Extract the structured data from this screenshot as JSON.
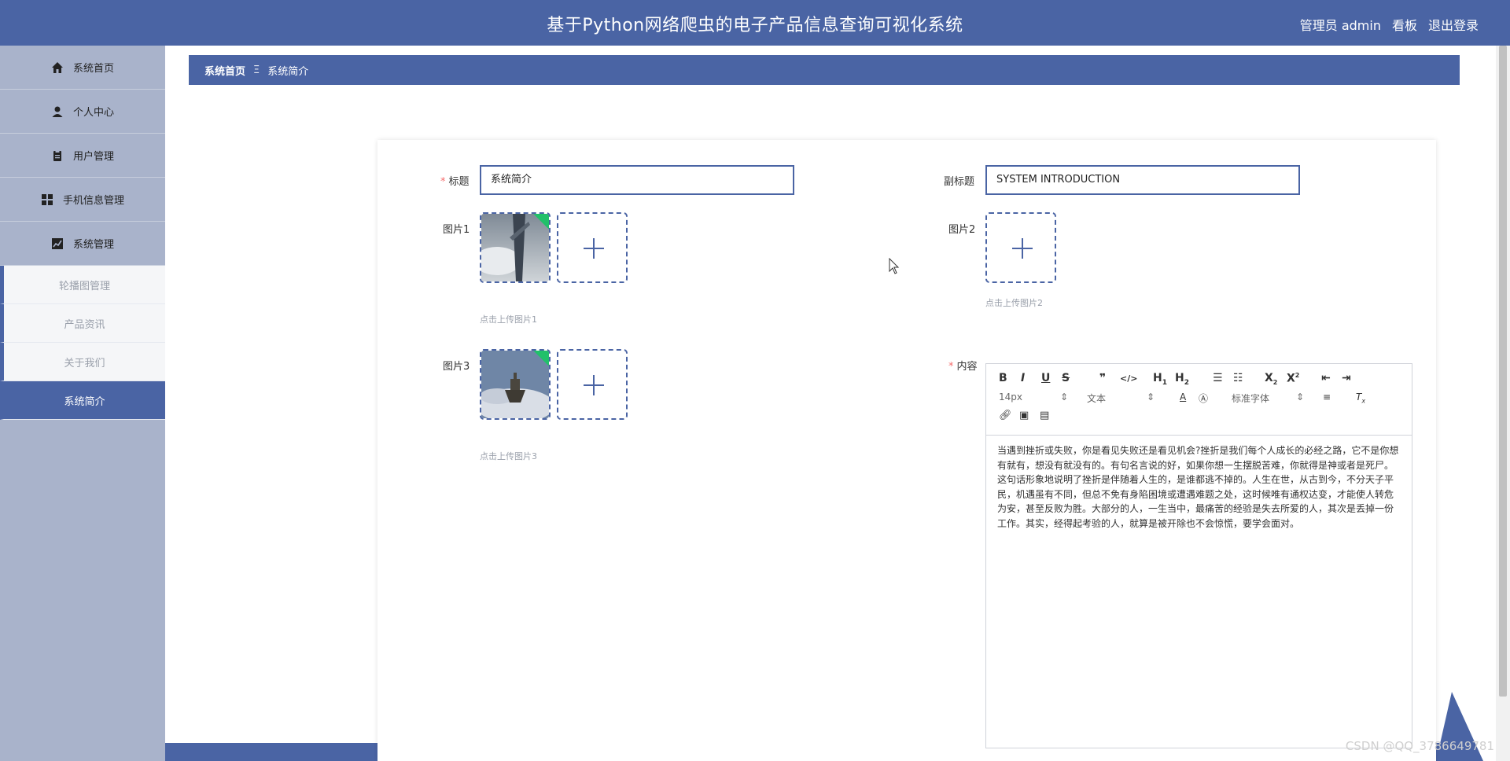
{
  "header": {
    "title": "基于Python网络爬虫的电子产品信息查询可视化系统",
    "admin_label": "管理员 admin",
    "board_label": "看板",
    "logout_label": "退出登录"
  },
  "sidebar": {
    "items": [
      {
        "label": "系统首页",
        "icon": "home-icon"
      },
      {
        "label": "个人中心",
        "icon": "user-icon"
      },
      {
        "label": "用户管理",
        "icon": "clipboard-icon"
      },
      {
        "label": "手机信息管理",
        "icon": "grid-icon"
      },
      {
        "label": "系统管理",
        "icon": "chart-icon"
      }
    ],
    "subitems": [
      {
        "label": "轮播图管理"
      },
      {
        "label": "产品资讯"
      },
      {
        "label": "关于我们"
      },
      {
        "label": "系统简介",
        "active": true
      }
    ]
  },
  "breadcrumb": {
    "home": "系统首页",
    "separator": "Ξ",
    "current": "系统简介"
  },
  "form": {
    "title_label": "标题",
    "title_value": "系统简介",
    "subtitle_label": "副标题",
    "subtitle_value": "SYSTEM INTRODUCTION",
    "image1_label": "图片1",
    "image1_hint": "点击上传图片1",
    "image2_label": "图片2",
    "image2_hint": "点击上传图片2",
    "image3_label": "图片3",
    "image3_hint": "点击上传图片3",
    "content_label": "内容"
  },
  "editor": {
    "font_size": "14px",
    "paragraph": "文本",
    "font_family": "标准字体",
    "content": "当遇到挫折或失败，你是看见失败还是看见机会?挫折是我们每个人成长的必经之路，它不是你想有就有，想没有就没有的。有句名言说的好，如果你想一生摆脱苦难，你就得是神或者是死尸。这句话形象地说明了挫折是伴随着人生的，是谁都逃不掉的。人生在世，从古到今，不分天子平民，机遇虽有不同，但总不免有身陷困境或遭遇难题之处，这时候唯有通权达变，才能使人转危为安，甚至反败为胜。大部分的人，一生当中，最痛苦的经验是失去所爱的人，其次是丢掉一份工作。其实，经得起考验的人，就算是被开除也不会惊慌，要学会面对。"
  },
  "watermark": "CSDN @QQ_3786649781",
  "colors": {
    "primary": "#4a64a4",
    "sidebar": "#a9b3cb",
    "required": "#f56c6c"
  }
}
